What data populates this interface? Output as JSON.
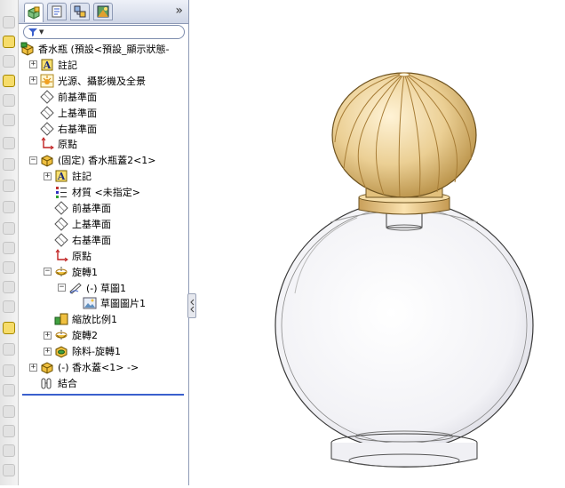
{
  "panel": {
    "tabs": [
      {
        "name": "feature-manager",
        "icon": "featuremanager-tab-icon",
        "active": true
      },
      {
        "name": "property-manager",
        "icon": "propertymanager-tab-icon",
        "active": false
      },
      {
        "name": "configuration-manager",
        "icon": "configurationmanager-tab-icon",
        "active": false
      },
      {
        "name": "display-manager",
        "icon": "displaymanager-tab-icon",
        "active": false
      }
    ],
    "more_glyph": "»",
    "filter_glyph": "▼"
  },
  "tree": {
    "items": [
      {
        "label": "香水瓶 (預設<預設_顯示狀態-",
        "icon": "part-icon",
        "level": 0,
        "expander": ""
      },
      {
        "label": "註記",
        "icon": "annotations-icon",
        "level": 1,
        "expander": "+"
      },
      {
        "label": "光源、攝影機及全景",
        "icon": "lights-camera-icon",
        "level": 1,
        "expander": "+"
      },
      {
        "label": "前基準面",
        "icon": "plane-icon",
        "level": 1,
        "expander": ""
      },
      {
        "label": "上基準面",
        "icon": "plane-icon",
        "level": 1,
        "expander": ""
      },
      {
        "label": "右基準面",
        "icon": "plane-icon",
        "level": 1,
        "expander": ""
      },
      {
        "label": "原點",
        "icon": "origin-icon",
        "level": 1,
        "expander": ""
      },
      {
        "label": "(固定) 香水瓶蓋2<1>",
        "icon": "component-icon",
        "level": 1,
        "expander": "−"
      },
      {
        "label": "註記",
        "icon": "annotations-icon",
        "level": 2,
        "expander": "+"
      },
      {
        "label": "材質 <未指定>",
        "icon": "material-icon",
        "level": 2,
        "expander": ""
      },
      {
        "label": "前基準面",
        "icon": "plane-icon",
        "level": 2,
        "expander": ""
      },
      {
        "label": "上基準面",
        "icon": "plane-icon",
        "level": 2,
        "expander": ""
      },
      {
        "label": "右基準面",
        "icon": "plane-icon",
        "level": 2,
        "expander": ""
      },
      {
        "label": "原點",
        "icon": "origin-icon",
        "level": 2,
        "expander": ""
      },
      {
        "label": "旋轉1",
        "icon": "revolve-icon",
        "level": 2,
        "expander": "−"
      },
      {
        "label": "(-) 草圖1",
        "icon": "sketch-icon",
        "level": 3,
        "expander": "−"
      },
      {
        "label": "草圖圖片1",
        "icon": "sketch-picture-icon",
        "level": 4,
        "expander": ""
      },
      {
        "label": "縮放比例1",
        "icon": "scale-icon",
        "level": 2,
        "expander": ""
      },
      {
        "label": "旋轉2",
        "icon": "revolve-icon",
        "level": 2,
        "expander": "+"
      },
      {
        "label": "除料-旋轉1",
        "icon": "cut-revolve-icon",
        "level": 2,
        "expander": "+"
      },
      {
        "label": "(-) 香水蓋<1> ->",
        "icon": "component-icon",
        "level": 1,
        "expander": "+"
      },
      {
        "label": "結合",
        "icon": "mates-icon",
        "level": 1,
        "expander": ""
      }
    ]
  },
  "colors": {
    "selection_accent": "#3a5fcd",
    "cap_gold": "#e8c98a",
    "bottle_outline": "#3a3a3a"
  }
}
